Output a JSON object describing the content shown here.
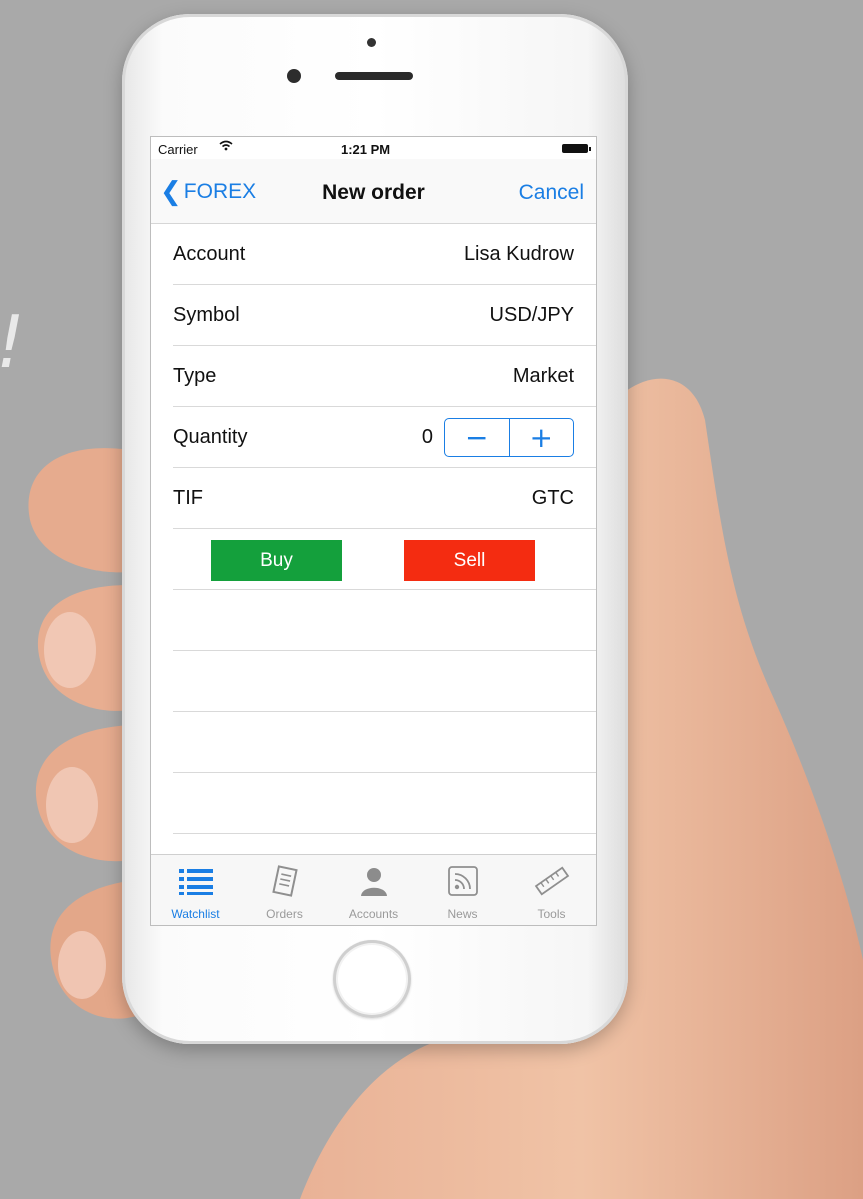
{
  "background": {
    "text": "!"
  },
  "status_bar": {
    "carrier": "Carrier",
    "time": "1:21 PM"
  },
  "nav": {
    "back_label": "FOREX",
    "title": "New order",
    "cancel_label": "Cancel"
  },
  "form": {
    "account": {
      "label": "Account",
      "value": "Lisa Kudrow"
    },
    "symbol": {
      "label": "Symbol",
      "value": "USD/JPY"
    },
    "type": {
      "label": "Type",
      "value": "Market"
    },
    "quantity": {
      "label": "Quantity",
      "value": "0",
      "decrement": "−",
      "increment": "+"
    },
    "tif": {
      "label": "TIF",
      "value": "GTC"
    }
  },
  "actions": {
    "buy_label": "Buy",
    "sell_label": "Sell"
  },
  "tabs": [
    {
      "label": "Watchlist",
      "icon": "list-icon",
      "active": true
    },
    {
      "label": "Orders",
      "icon": "document-icon",
      "active": false
    },
    {
      "label": "Accounts",
      "icon": "person-icon",
      "active": false
    },
    {
      "label": "News",
      "icon": "rss-icon",
      "active": false
    },
    {
      "label": "Tools",
      "icon": "ruler-icon",
      "active": false
    }
  ],
  "colors": {
    "accent": "#1a7ee4",
    "buy": "#14a03c",
    "sell": "#f42c11",
    "background": "#a9a9a9"
  }
}
